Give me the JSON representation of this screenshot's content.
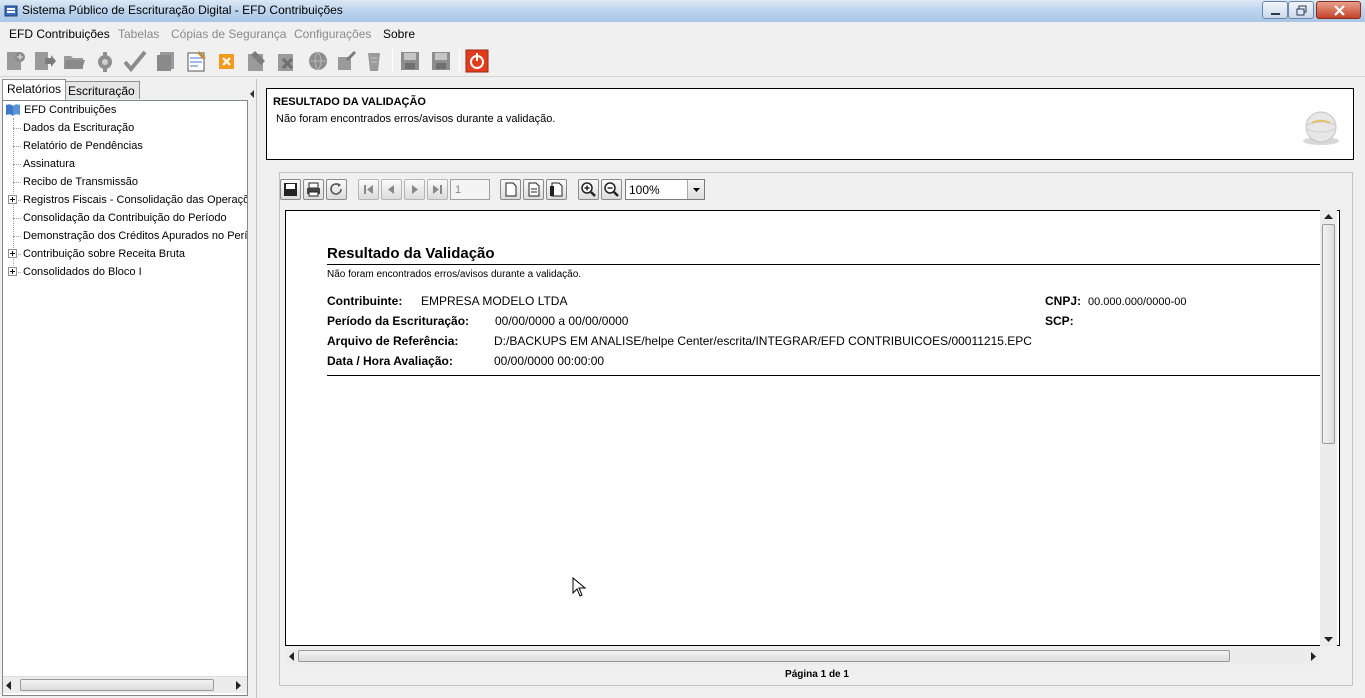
{
  "window": {
    "title": "Sistema Público de Escrituração Digital - EFD Contribuições"
  },
  "menu": {
    "items": [
      {
        "label": "EFD Contribuições",
        "enabled": true
      },
      {
        "label": "Tabelas",
        "enabled": false
      },
      {
        "label": "Cópias de Segurança",
        "enabled": false
      },
      {
        "label": "Configurações",
        "enabled": false
      },
      {
        "label": "Sobre",
        "enabled": true
      }
    ]
  },
  "toolbar": {
    "icons": [
      "new-file-icon",
      "import-icon",
      "open-folder-icon",
      "settings-gear-icon",
      "validate-check-icon",
      "copy-icon",
      "edit-notes-icon",
      "delete-x-icon",
      "sign-icon",
      "sign-alt-icon",
      "transmit-globe-icon",
      "search-icon",
      "receipt-icon",
      "save-disk-icon",
      "save-disk-alt-icon",
      "exit-power-icon"
    ],
    "exit_color": "#e03c1e"
  },
  "left_panel": {
    "tabs": [
      "Relatórios",
      "Escrituração"
    ],
    "active_tab": "Relatórios",
    "tree": {
      "root": "EFD Contribuições",
      "items": [
        {
          "label": "Dados da Escrituração",
          "expandable": false
        },
        {
          "label": "Relatório de Pendências",
          "expandable": false
        },
        {
          "label": "Assinatura",
          "expandable": false
        },
        {
          "label": "Recibo de Transmissão",
          "expandable": false
        },
        {
          "label": "Registros Fiscais - Consolidação das Operaçõ",
          "expandable": true
        },
        {
          "label": "Consolidação da Contribuição do Período",
          "expandable": false
        },
        {
          "label": "Demonstração dos Créditos Apurados no Perío",
          "expandable": false
        },
        {
          "label": "Contribuição sobre Receita Bruta",
          "expandable": true
        },
        {
          "label": "Consolidados do Bloco I",
          "expandable": true
        }
      ]
    }
  },
  "result_box": {
    "heading": "RESULTADO DA VALIDAÇÃO",
    "message": "Não foram encontrados erros/avisos durante a validação."
  },
  "viewer": {
    "page_number": "1",
    "zoom": "100%",
    "page_info": "Página 1 de 1",
    "report": {
      "title": "Resultado da Validação",
      "subtitle": "Não foram encontrados erros/avisos durante a validação.",
      "contribuinte_label": "Contribuinte:",
      "contribuinte_value": "EMPRESA MODELO LTDA",
      "cnpj_label": "CNPJ:",
      "cnpj_value": "00.000.000/0000-00",
      "periodo_label": "Período da Escrituração:",
      "periodo_value": "00/00/0000 a 00/00/0000",
      "scp_label": "SCP:",
      "scp_value": "",
      "arquivo_label": "Arquivo de Referência:",
      "arquivo_value": "D:/BACKUPS EM ANALISE/helpe Center/escrita/INTEGRAR/EFD CONTRIBUICOES/00011215.EPC",
      "data_label": "Data / Hora Avaliação:",
      "data_value": "00/00/0000 00:00:00"
    }
  }
}
